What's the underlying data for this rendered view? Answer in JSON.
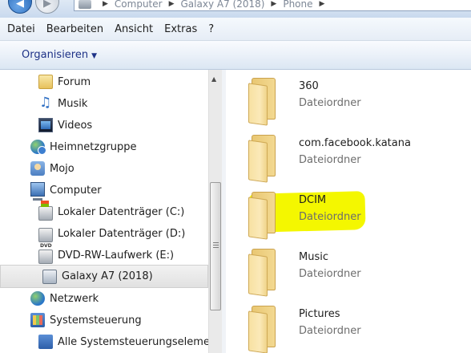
{
  "address_bar": {
    "breadcrumbs": [
      "Computer",
      "Galaxy A7 (2018)",
      "Phone"
    ],
    "separator": "▶"
  },
  "menu_bar": {
    "items": [
      "Datei",
      "Bearbeiten",
      "Ansicht",
      "Extras",
      "?"
    ]
  },
  "command_bar": {
    "organize_label": "Organisieren"
  },
  "nav_tree": {
    "items": [
      {
        "label": "Forum",
        "icon": "folder-icon"
      },
      {
        "label": "Musik",
        "icon": "music-library-icon"
      },
      {
        "label": "Videos",
        "icon": "video-library-icon"
      },
      {
        "label": "Heimnetzgruppe",
        "icon": "homegroup-icon"
      },
      {
        "label": "Mojo",
        "icon": "user-folder-icon"
      },
      {
        "label": "Computer",
        "icon": "computer-icon"
      },
      {
        "label": "Lokaler Datenträger (C:)",
        "icon": "system-drive-icon"
      },
      {
        "label": "Lokaler Datenträger (D:)",
        "icon": "hard-drive-icon"
      },
      {
        "label": "DVD-RW-Laufwerk (E:)",
        "icon": "dvd-drive-icon"
      },
      {
        "label": "Galaxy A7 (2018)",
        "icon": "phone-icon",
        "selected": true
      },
      {
        "label": "Netzwerk",
        "icon": "network-icon"
      },
      {
        "label": "Systemsteuerung",
        "icon": "control-panel-icon"
      },
      {
        "label": "Alle Systemsteuerungselemente",
        "icon": "control-panel-items-icon"
      }
    ]
  },
  "content": {
    "folders": [
      {
        "name": "360",
        "type": "Dateiordner"
      },
      {
        "name": "com.facebook.katana",
        "type": "Dateiordner"
      },
      {
        "name": "DCIM",
        "type": "Dateiordner",
        "highlighted": true
      },
      {
        "name": "Music",
        "type": "Dateiordner"
      },
      {
        "name": "Pictures",
        "type": "Dateiordner"
      }
    ]
  },
  "colors": {
    "highlight": "#f4f700",
    "folder": "#f3d992",
    "link_text": "#1e3287"
  }
}
